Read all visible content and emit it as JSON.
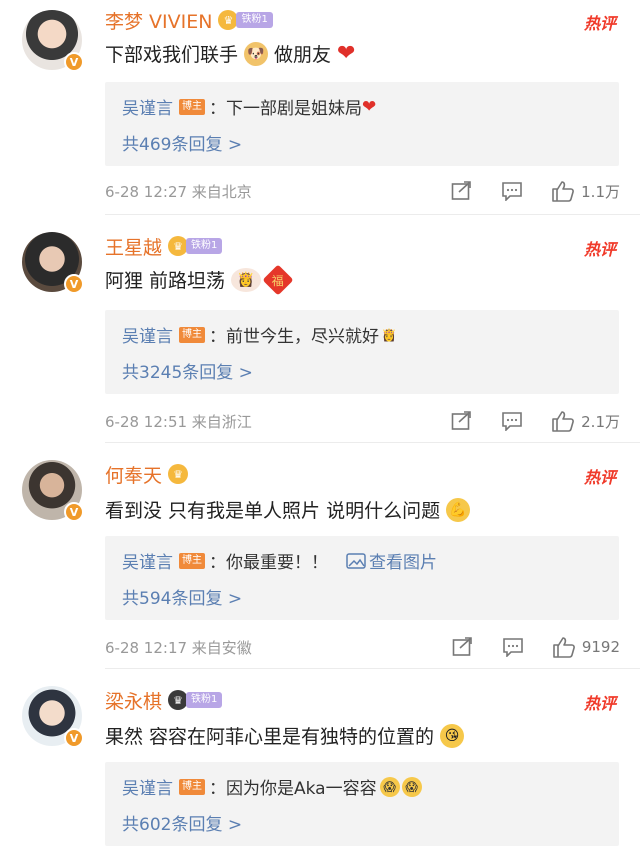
{
  "comments": [
    {
      "name": "李梦 VIVIEN",
      "fan_badge": "铁粉1",
      "hot": "热评",
      "text": "下部戏我们联手",
      "text2": "做朋友",
      "reply_author": "吴谨言",
      "reply_badge": "博主",
      "reply_text": "：下一部剧是姐妹局",
      "reply_count": "共469条回复 >",
      "meta": "6-28 12:27  来自北京",
      "likes": "1.1万"
    },
    {
      "name": "王星越",
      "fan_badge": "铁粉1",
      "hot": "热评",
      "text": "阿狸 前路坦荡",
      "reply_author": "吴谨言",
      "reply_badge": "博主",
      "reply_text": "：前世今生，尽兴就好",
      "reply_count": "共3245条回复 >",
      "meta": "6-28 12:51  来自浙江",
      "likes": "2.1万"
    },
    {
      "name": "何奉天",
      "hot": "热评",
      "text": "看到没 只有我是单人照片 说明什么问题",
      "reply_author": "吴谨言",
      "reply_badge": "博主",
      "reply_text": "：你最重要！！",
      "reply_link": "查看图片",
      "reply_count": "共594条回复 >",
      "meta": "6-28 12:17  来自安徽",
      "likes": "9192"
    },
    {
      "name": "梁永棋",
      "fan_badge": "铁粉1",
      "hot": "热评",
      "text": "果然 容容在阿菲心里是有独特的位置的",
      "reply_author": "吴谨言",
      "reply_badge": "博主",
      "reply_text": "：因为你是Aka一容容",
      "reply_count": "共602条回复 >"
    }
  ],
  "icons": {
    "share": "share-icon",
    "comment": "comment-icon",
    "like": "thumbs-up-icon",
    "verified": "v-badge-icon",
    "crown": "crown-icon"
  },
  "colors": {
    "name": "#e6732a",
    "link": "#5b7fb2",
    "hot": "#f03a2a",
    "verified": "#f09a2a"
  }
}
